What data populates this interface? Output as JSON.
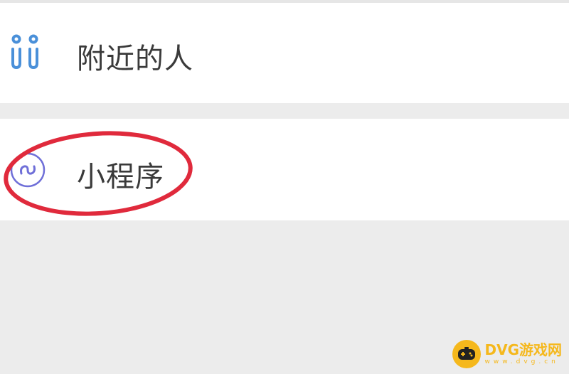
{
  "menu": {
    "items": [
      {
        "label": "附近的人",
        "icon": "people-nearby-icon"
      },
      {
        "label": "小程序",
        "icon": "mini-program-icon"
      }
    ],
    "highlight_color": "#e02a3c",
    "icon_colors": {
      "people-nearby-icon": "#4a90d9",
      "mini-program-icon": "#6f6fd8"
    }
  },
  "watermark": {
    "brand": "DVG游戏网",
    "domain": "www.dvg.cn",
    "color": "#f5b81c"
  }
}
